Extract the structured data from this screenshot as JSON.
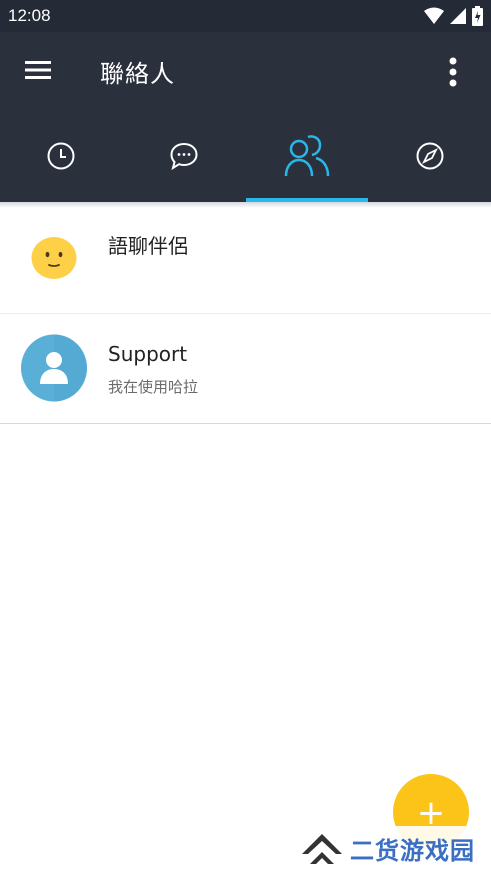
{
  "status_bar": {
    "time": "12:08"
  },
  "app_bar": {
    "title": "聯絡人"
  },
  "tabs": [
    {
      "icon": "clock-icon",
      "active": false
    },
    {
      "icon": "chat-bubble-icon",
      "active": false
    },
    {
      "icon": "contacts-icon",
      "active": true
    },
    {
      "icon": "compass-icon",
      "active": false
    }
  ],
  "contacts": [
    {
      "name": "語聊伴侶",
      "status": "",
      "avatar": "emoji-face-icon"
    },
    {
      "name": "Support",
      "status": "我在使用哈拉",
      "avatar": "person-avatar-icon"
    }
  ],
  "fab": {
    "label": "+"
  },
  "watermark": {
    "text": "二货游戏园"
  },
  "colors": {
    "app_bar": "#2a303c",
    "status_bar": "#242a36",
    "accent": "#29b6e8",
    "fab": "#fcc419",
    "emoji": "#fdd048",
    "support_avatar": "#5aafd7"
  }
}
